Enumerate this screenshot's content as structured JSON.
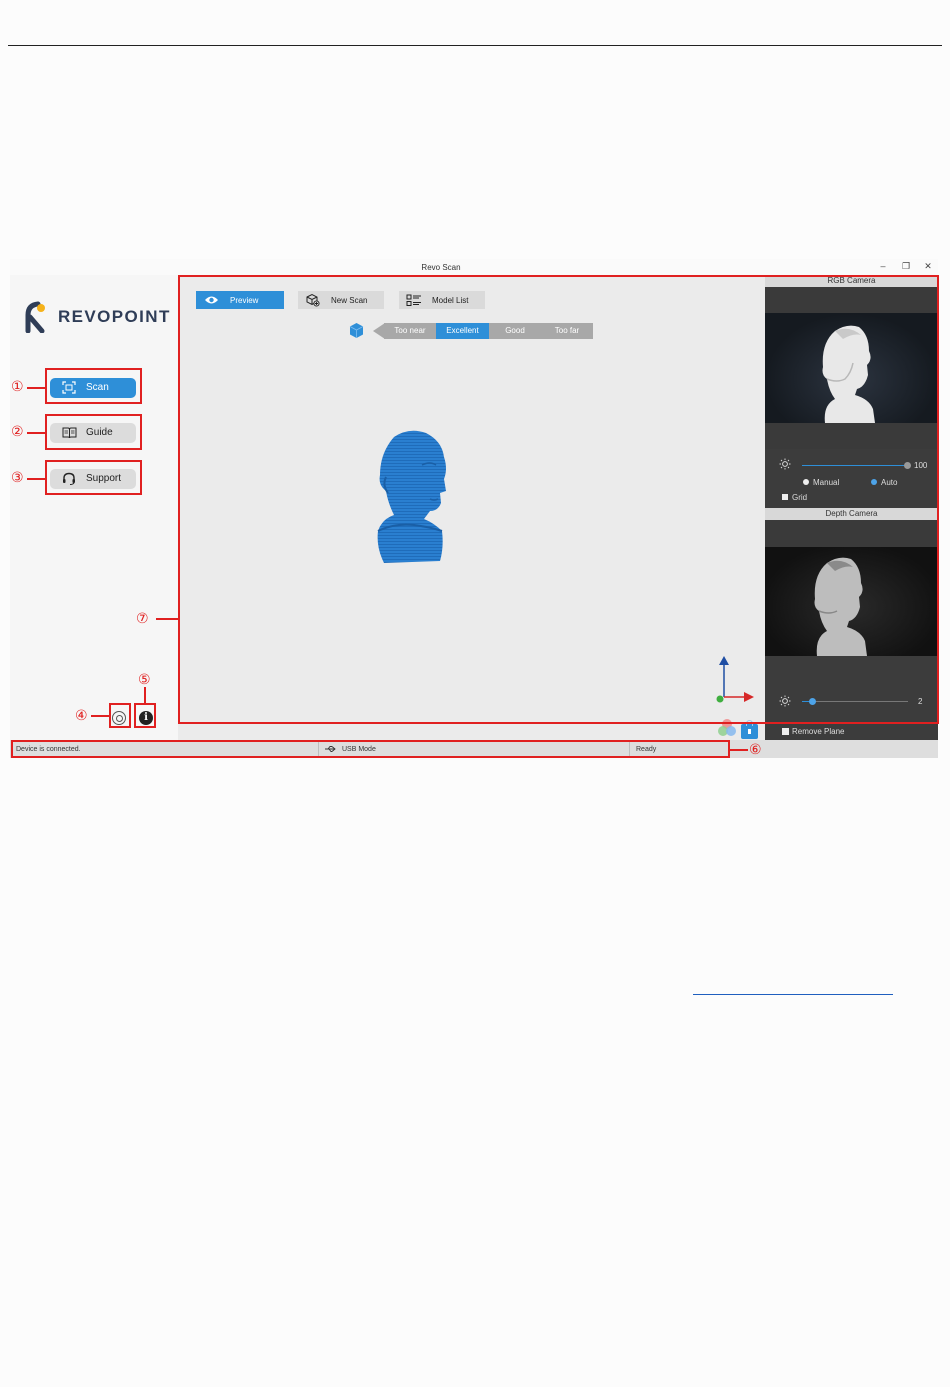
{
  "window": {
    "title": "Revo Scan",
    "minimize": "–",
    "restore": "❐",
    "close": "✕"
  },
  "brand": {
    "logo_text": "REVOPOINT",
    "accent": "#2e8fd8",
    "logo_color": "#2f3d57",
    "callout_color": "#e02020"
  },
  "sidebar": {
    "items": [
      {
        "label": "Scan",
        "icon": "scan-icon",
        "active": true
      },
      {
        "label": "Guide",
        "icon": "book-icon"
      },
      {
        "label": "Support",
        "icon": "headset-icon"
      }
    ],
    "footer_icons": [
      "settings-icon",
      "info-icon"
    ]
  },
  "toolbar": {
    "preview_label": "Preview",
    "new_scan_label": "New Scan",
    "model_list_label": "Model List"
  },
  "distance": {
    "levels": [
      "Too near",
      "Excellent",
      "Good",
      "Too far"
    ],
    "selected": "Excellent"
  },
  "rgb_camera": {
    "title": "RGB Camera",
    "brightness_value": "100",
    "brightness_fraction": 1.0,
    "mode_manual": "Manual",
    "mode_auto": "Auto",
    "selected_mode": "Auto",
    "grid_label": "Grid"
  },
  "depth_camera": {
    "title": "Depth Camera",
    "exposure_value": "2",
    "exposure_fraction": 0.1,
    "remove_plane_label": "Remove Plane"
  },
  "status": {
    "left": "Device is connected.",
    "mode": "USB Mode",
    "state": "Ready"
  },
  "callouts": [
    "①",
    "②",
    "③",
    "④",
    "⑤",
    "⑥",
    "⑦"
  ]
}
